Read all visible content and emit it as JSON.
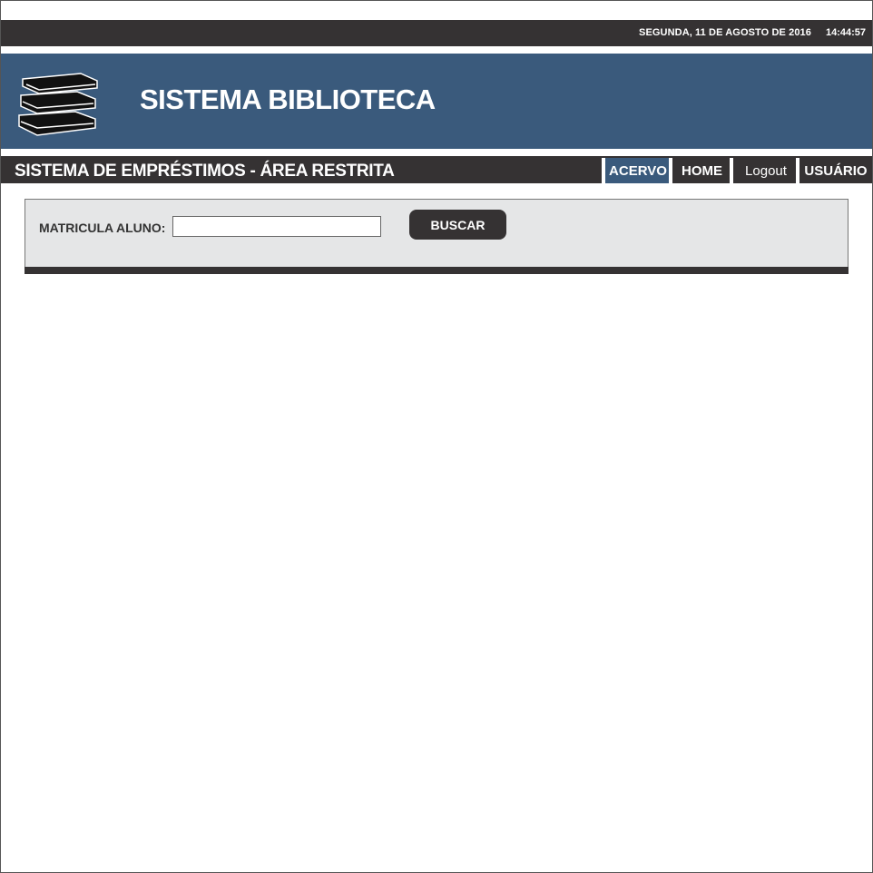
{
  "topbar": {
    "date": "SEGUNDA, 11 DE AGOSTO DE 2016",
    "time": "14:44:57"
  },
  "banner": {
    "title": "SISTEMA BIBLIOTECA",
    "logo_icon": "books-stack-icon"
  },
  "subbar": {
    "title": "SISTEMA DE EMPRÉSTIMOS - ÁREA RESTRITA",
    "nav": [
      {
        "label": "ACERVO",
        "active": true
      },
      {
        "label": "HOME",
        "active": false
      },
      {
        "label": "Logout",
        "active": false
      },
      {
        "label": "USUÁRIO",
        "active": false
      }
    ]
  },
  "search": {
    "label": "MATRICULA ALUNO:",
    "value": "",
    "placeholder": "",
    "button_label": "BUSCAR"
  },
  "colors": {
    "dark": "#353233",
    "accent_blue": "#3a5a7c",
    "panel_gray": "#e5e6e7"
  }
}
